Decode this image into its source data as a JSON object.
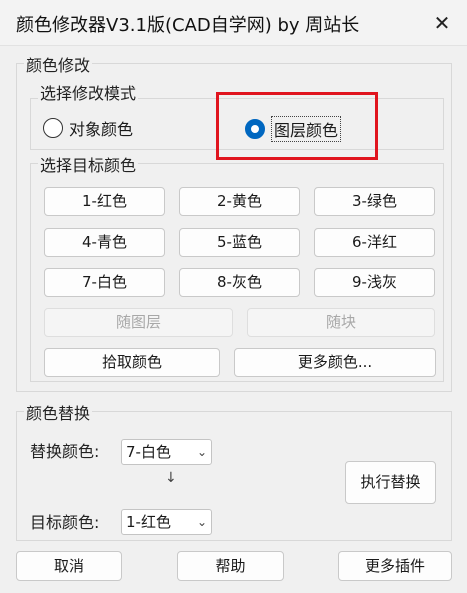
{
  "window": {
    "title": "颜色修改器V3.1版(CAD自学网) by 周站长",
    "close_glyph": "✕"
  },
  "color_modify": {
    "group_label": "颜色修改",
    "mode": {
      "group_label": "选择修改模式",
      "options": [
        {
          "label": "对象颜色",
          "selected": false
        },
        {
          "label": "图层颜色",
          "selected": true
        }
      ]
    },
    "target": {
      "group_label": "选择目标颜色",
      "colors": [
        "1-红色",
        "2-黄色",
        "3-绿色",
        "4-青色",
        "5-蓝色",
        "6-洋红",
        "7-白色",
        "8-灰色",
        "9-浅灰"
      ],
      "by_layer": "随图层",
      "by_block": "随块",
      "pick_color": "拾取颜色",
      "more_colors": "更多颜色..."
    }
  },
  "replace": {
    "group_label": "颜色替换",
    "replace_label": "替换颜色:",
    "replace_value": "7-白色",
    "arrow": "↓",
    "target_label": "目标颜色:",
    "target_value": "1-红色",
    "execute": "执行替换"
  },
  "footer": {
    "cancel": "取消",
    "help": "帮助",
    "more_plugins": "更多插件"
  },
  "colors": {
    "accent": "#0067c0",
    "highlight_box": "#e0141e"
  }
}
